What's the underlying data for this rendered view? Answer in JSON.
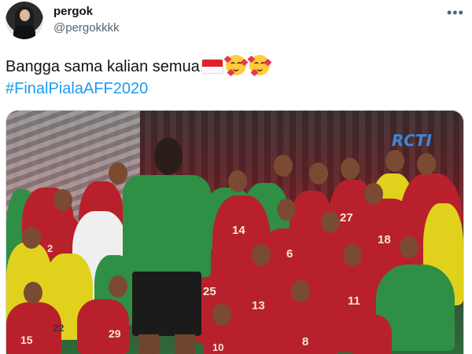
{
  "tweet": {
    "display_name": "pergok",
    "handle": "@pergokkkk",
    "more_icon": "more-horizontal-icon",
    "text_line1": "Bangga sama kalian semua",
    "hashtag": "#FinalPialaAFF2020",
    "emojis": [
      "flag-indonesia",
      "smiling-face-with-hearts",
      "smiling-face-with-hearts"
    ]
  },
  "media": {
    "broadcaster_logo": "RCTI",
    "jersey_numbers": [
      "14",
      "27",
      "18",
      "6",
      "25",
      "13",
      "11",
      "8",
      "15",
      "29",
      "10",
      "22",
      "2"
    ]
  },
  "colors": {
    "hashtag_blue": "#1d9bf0",
    "handle_gray": "#536471",
    "jersey_red": "#b8212b",
    "keeper_yellow": "#e0d21c",
    "coach_green": "#2f8f45"
  }
}
